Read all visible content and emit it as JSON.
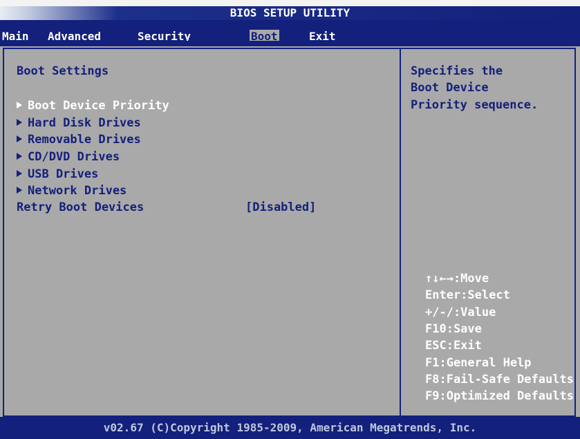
{
  "title": "BIOS SETUP UTILITY",
  "tabs": [
    {
      "label": "Main"
    },
    {
      "label": "Advanced"
    },
    {
      "label": "Security"
    },
    {
      "label": "Boot"
    },
    {
      "label": "Exit"
    }
  ],
  "selected_tab": "Boot",
  "section_title": "Boot Settings",
  "menu_items": [
    {
      "label": "Boot Device Priority"
    },
    {
      "label": "Hard Disk Drives"
    },
    {
      "label": "Removable Drives"
    },
    {
      "label": "CD/DVD Drives"
    },
    {
      "label": "USB Drives"
    },
    {
      "label": "Network Drives"
    }
  ],
  "selected_item": "Boot Device Priority",
  "retry": {
    "label": "Retry Boot Devices",
    "value": "[Disabled]"
  },
  "help": {
    "line1": "Specifies the",
    "line2": "Boot Device",
    "line3": "Priority sequence."
  },
  "keys": [
    "↑↓←→:Move",
    "Enter:Select",
    "+/-/:Value",
    "F10:Save",
    "ESC:Exit",
    "F1:General Help",
    "F8:Fail-Safe Defaults",
    "F9:Optimized Defaults"
  ],
  "footer": "v02.67 (C)Copyright 1985-2009, American Megatrends, Inc.",
  "colors": {
    "background": "#a9a9a9",
    "bar": "#13207c",
    "text": "#14207c",
    "highlight": "#ffffff"
  }
}
